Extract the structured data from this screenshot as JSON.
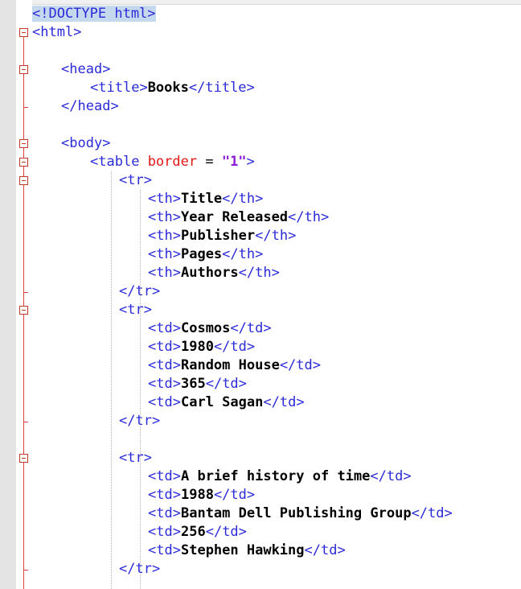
{
  "editor": {
    "lines": [
      {
        "type": "doctype",
        "text": "<!DOCTYPE html>",
        "indent": 0
      },
      {
        "type": "open",
        "tag": "html",
        "indent": 0
      },
      {
        "type": "blank"
      },
      {
        "type": "open",
        "tag": "head",
        "indent": 1
      },
      {
        "type": "element",
        "tag": "title",
        "content": "Books",
        "indent": 2
      },
      {
        "type": "close",
        "tag": "head",
        "indent": 1
      },
      {
        "type": "blank"
      },
      {
        "type": "open",
        "tag": "body",
        "indent": 1
      },
      {
        "type": "open_attr",
        "tag": "table",
        "attr": "border",
        "op": " = ",
        "value": "\"1\"",
        "indent": 2
      },
      {
        "type": "open",
        "tag": "tr",
        "indent": 3
      },
      {
        "type": "element",
        "tag": "th",
        "content": "Title",
        "indent": 4
      },
      {
        "type": "element",
        "tag": "th",
        "content": "Year Released",
        "indent": 4
      },
      {
        "type": "element",
        "tag": "th",
        "content": "Publisher",
        "indent": 4
      },
      {
        "type": "element",
        "tag": "th",
        "content": "Pages",
        "indent": 4
      },
      {
        "type": "element",
        "tag": "th",
        "content": "Authors",
        "indent": 4
      },
      {
        "type": "close",
        "tag": "tr",
        "indent": 3
      },
      {
        "type": "open",
        "tag": "tr",
        "indent": 3
      },
      {
        "type": "element",
        "tag": "td",
        "content": "Cosmos",
        "indent": 4
      },
      {
        "type": "element",
        "tag": "td",
        "content": "1980",
        "indent": 4
      },
      {
        "type": "element",
        "tag": "td",
        "content": "Random House",
        "indent": 4
      },
      {
        "type": "element",
        "tag": "td",
        "content": "365",
        "indent": 4
      },
      {
        "type": "element",
        "tag": "td",
        "content": "Carl Sagan",
        "indent": 4
      },
      {
        "type": "close",
        "tag": "tr",
        "indent": 3
      },
      {
        "type": "blank"
      },
      {
        "type": "open",
        "tag": "tr",
        "indent": 3
      },
      {
        "type": "element",
        "tag": "td",
        "content": "A brief history of time",
        "indent": 4
      },
      {
        "type": "element",
        "tag": "td",
        "content": "1988",
        "indent": 4
      },
      {
        "type": "element",
        "tag": "td",
        "content": "Bantam Dell Publishing Group",
        "indent": 4
      },
      {
        "type": "element",
        "tag": "td",
        "content": "256",
        "indent": 4
      },
      {
        "type": "element",
        "tag": "td",
        "content": "Stephen Hawking",
        "indent": 4
      },
      {
        "type": "close",
        "tag": "tr",
        "indent": 3
      }
    ],
    "colors": {
      "tag": "#2b2bd8",
      "attribute": "#e01818",
      "value": "#8a1bd6",
      "text": "#000000",
      "fold_marker": "#c0392b",
      "doctype_highlight": "#c4d8ee"
    }
  }
}
